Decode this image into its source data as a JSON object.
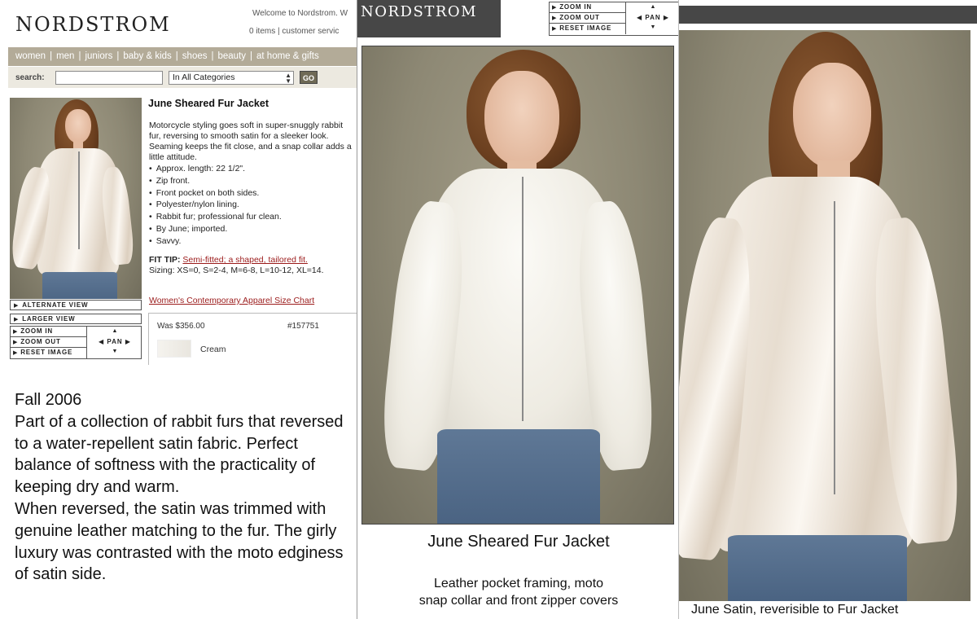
{
  "left": {
    "logo": "NORDSTROM",
    "welcome": "Welcome to Nordstrom. W",
    "utility_links": "0 items | customer servic",
    "nav": [
      "women",
      "men",
      "juniors",
      "baby & kids",
      "shoes",
      "beauty",
      "at home & gifts"
    ],
    "search": {
      "label": "search:",
      "value": "",
      "category": "In All Categories",
      "go_label": "GO"
    },
    "view_buttons": {
      "alternate": "ALTERNATE VIEW",
      "larger": "LARGER VIEW"
    },
    "zoom": {
      "zoom_in": "ZOOM IN",
      "zoom_out": "ZOOM OUT",
      "reset": "RESET IMAGE",
      "pan": "PAN"
    },
    "product": {
      "title": "June Sheared Fur Jacket",
      "description": "Motorcycle styling goes soft in super-snuggly rabbit fur, reversing to smooth satin for a sleeker look. Seaming keeps the fit close, and a snap collar adds a little attitude.",
      "bullets": [
        "Approx. length: 22 1/2\".",
        "Zip front.",
        "Front pocket on both sides.",
        "Polyester/nylon lining.",
        "Rabbit fur; professional fur clean.",
        "By June; imported.",
        "Savvy."
      ],
      "fit_tip_label": "FIT TIP:",
      "fit_tip_link": "Semi-fitted; a shaped, tailored fit.",
      "sizing": "Sizing: XS=0, S=2-4, M=6-8, L=10-12, XL=14.",
      "size_chart_link": "Women's Contemporary Apparel Size Chart",
      "was_price": "Was $356.00",
      "item_number": "#157751",
      "color": "Cream"
    },
    "story": [
      "Fall 2006",
      "Part of a collection of rabbit furs that reversed to a water-repellent satin fabric. Perfect balance of softness with the practicality of keeping dry and warm.",
      "When reversed, the satin was trimmed with genuine leather matching to the fur.  The girly luxury was contrasted with the moto edginess of satin side."
    ]
  },
  "middle": {
    "logo": "NORDSTROM",
    "zoom": {
      "zoom_in": "ZOOM IN",
      "zoom_out": "ZOOM OUT",
      "reset": "RESET IMAGE",
      "pan": "PAN"
    },
    "title": "June Sheared Fur Jacket",
    "caption_line1": "Leather pocket framing, moto",
    "caption_line2": "snap collar and front zipper covers"
  },
  "right": {
    "caption": "June Satin, reverisible to Fur Jacket"
  },
  "colors": {
    "nav_bar": "#b3ab98",
    "header_dark": "#474747",
    "link_red": "#9b1b1b"
  }
}
